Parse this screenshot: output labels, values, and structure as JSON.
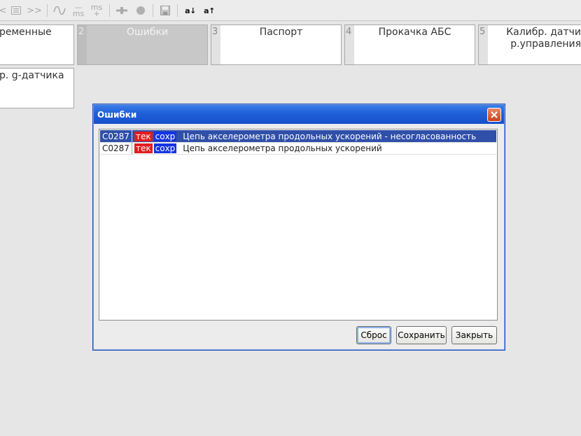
{
  "toolbar": {
    "back_glyph": "<",
    "forward_glyph": ">>",
    "ms_minus_top": "—",
    "ms_minus_bottom": "ms",
    "ms_plus_top": "ms",
    "ms_plus_bottom": "+",
    "sort_down_label": "a↓",
    "sort_up_label": "a↑",
    "icons": [
      "back-icon",
      "list-icon",
      "forward-icon",
      "wave-icon",
      "ms-decrease-icon",
      "ms-increase-icon",
      "crosshair-icon",
      "record-dot-icon",
      "save-icon",
      "sort-down-icon",
      "sort-up-icon"
    ]
  },
  "tiles": [
    {
      "number": "",
      "label": "ременные",
      "label2": ""
    },
    {
      "number": "2",
      "label": "Ошибки",
      "label2": "",
      "selected": true
    },
    {
      "number": "3",
      "label": "Паспорт",
      "label2": ""
    },
    {
      "number": "4",
      "label": "Прокачка АБС",
      "label2": ""
    },
    {
      "number": "5",
      "label": "Калибр. датчи",
      "label2": "р.управления"
    },
    {
      "number": "",
      "label": "р. g-датчика",
      "label2": ""
    }
  ],
  "dialog": {
    "title": "Ошибки",
    "rows": [
      {
        "code": "C0287",
        "badge_current": "тек",
        "badge_saved": "сохр",
        "text": "Цепь акселерометра продольных ускорений - несогласованность",
        "selected": true
      },
      {
        "code": "C0287",
        "badge_current": "тек",
        "badge_saved": "сохр",
        "text": "Цепь акселерометра продольных ускорений",
        "selected": false
      }
    ],
    "buttons": {
      "reset": "Сброс",
      "save": "Сохранить",
      "close": "Закрыть"
    }
  },
  "colors": {
    "title_bar": "#1f5fd8",
    "selected_row": "#2f4fa8",
    "badge_current": "#e31d1d",
    "badge_saved": "#1434e6"
  }
}
